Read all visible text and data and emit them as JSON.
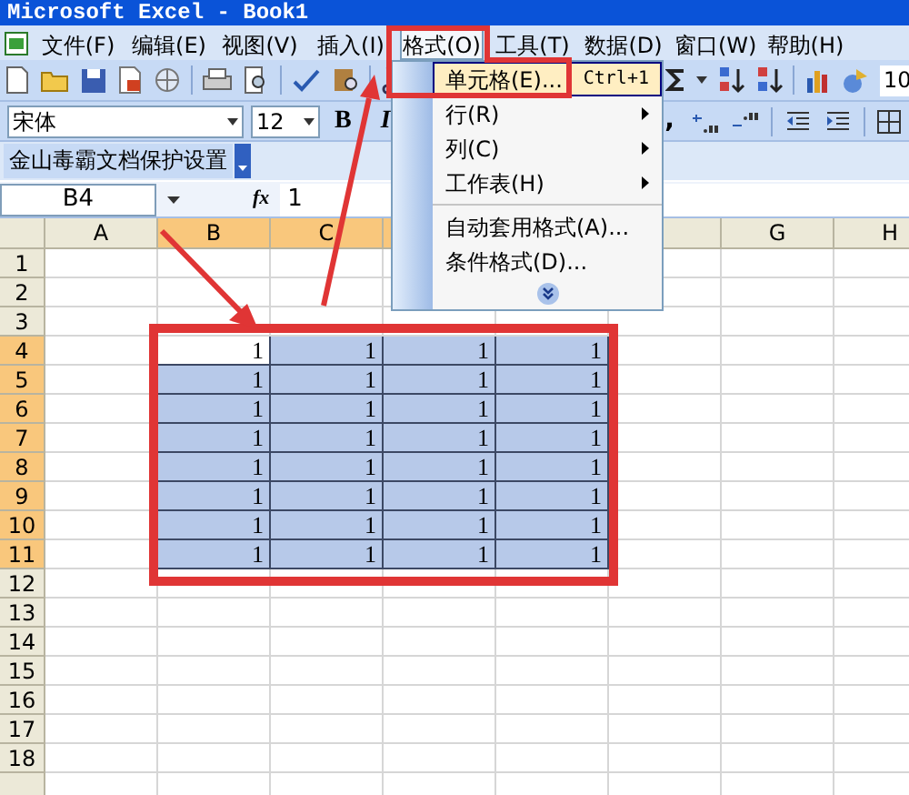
{
  "window": {
    "title": "Microsoft Excel - Book1"
  },
  "menu_bar": [
    {
      "label": "文件(F)",
      "selected": false
    },
    {
      "label": "编辑(E)",
      "selected": false
    },
    {
      "label": "视图(V)",
      "selected": false
    },
    {
      "label": "插入(I)",
      "selected": false
    },
    {
      "label": "格式(O)",
      "selected": true
    },
    {
      "label": "工具(T)",
      "selected": false
    },
    {
      "label": "数据(D)",
      "selected": false
    },
    {
      "label": "窗口(W)",
      "selected": false
    },
    {
      "label": "帮助(H)",
      "selected": false
    }
  ],
  "standard_toolbar": {
    "zoom": "10"
  },
  "formatting_toolbar": {
    "font": "宋体",
    "font_size": "12",
    "bold": "B",
    "italic": "I",
    "comma_style": ","
  },
  "addin_toolbar": {
    "button": "金山毒霸文档保护设置"
  },
  "formula_bar": {
    "name_box": "B4",
    "function_label": "fx",
    "value": "1"
  },
  "sheet": {
    "columns": [
      {
        "label": "A",
        "selected": false
      },
      {
        "label": "B",
        "selected": true
      },
      {
        "label": "C",
        "selected": true
      },
      {
        "selected": true
      },
      {},
      {
        "selected": false
      },
      {
        "label": "G",
        "selected": false
      },
      {
        "label": "H",
        "selected": false
      }
    ],
    "rows": [
      {
        "label": "1",
        "selected": false
      },
      {
        "label": "2",
        "selected": false
      },
      {
        "label": "3",
        "selected": false
      },
      {
        "label": "4",
        "selected": true,
        "cells": [
          {},
          {
            "text": "1",
            "selected": false
          },
          {
            "text": "1",
            "selected": true
          },
          {
            "text": "1",
            "selected": true
          },
          {
            "text": "1",
            "selected": true
          },
          {},
          {},
          {}
        ]
      },
      {
        "label": "5",
        "selected": true,
        "cells": [
          {},
          {
            "text": "1",
            "selected": true
          },
          {
            "text": "1",
            "selected": true
          },
          {
            "text": "1",
            "selected": true
          },
          {
            "text": "1",
            "selected": true
          },
          {},
          {},
          {}
        ]
      },
      {
        "label": "6",
        "selected": true,
        "cells": [
          {},
          {
            "text": "1",
            "selected": true
          },
          {
            "text": "1",
            "selected": true
          },
          {
            "text": "1",
            "selected": true
          },
          {
            "text": "1",
            "selected": true
          },
          {},
          {},
          {}
        ]
      },
      {
        "label": "7",
        "selected": true,
        "cells": [
          {},
          {
            "text": "1",
            "selected": true
          },
          {
            "text": "1",
            "selected": true
          },
          {
            "text": "1",
            "selected": true
          },
          {
            "text": "1",
            "selected": true
          },
          {},
          {},
          {}
        ]
      },
      {
        "label": "8",
        "selected": true,
        "cells": [
          {},
          {
            "text": "1",
            "selected": true
          },
          {
            "text": "1",
            "selected": true
          },
          {
            "text": "1",
            "selected": true
          },
          {
            "text": "1",
            "selected": true
          },
          {},
          {},
          {}
        ]
      },
      {
        "label": "9",
        "selected": true,
        "cells": [
          {},
          {
            "text": "1",
            "selected": true
          },
          {
            "text": "1",
            "selected": true
          },
          {
            "text": "1",
            "selected": true
          },
          {
            "text": "1",
            "selected": true
          },
          {},
          {},
          {}
        ]
      },
      {
        "label": "10",
        "selected": true,
        "cells": [
          {},
          {
            "text": "1",
            "selected": true
          },
          {
            "text": "1",
            "selected": true
          },
          {
            "text": "1",
            "selected": true
          },
          {
            "text": "1",
            "selected": true
          },
          {},
          {},
          {}
        ]
      },
      {
        "label": "11",
        "selected": true,
        "cells": [
          {},
          {
            "text": "1",
            "selected": true
          },
          {
            "text": "1",
            "selected": true
          },
          {
            "text": "1",
            "selected": true
          },
          {
            "text": "1",
            "selected": true
          },
          {},
          {},
          {}
        ]
      },
      {
        "label": "12",
        "selected": false
      },
      {
        "label": "13",
        "selected": false
      },
      {
        "label": "14",
        "selected": false
      },
      {
        "label": "15",
        "selected": false
      },
      {
        "label": "16",
        "selected": false
      },
      {
        "label": "17",
        "selected": false
      },
      {
        "label": "18",
        "selected": false
      },
      {
        "selected": false
      }
    ]
  },
  "format_menu": {
    "items": [
      {
        "kind": "command",
        "label": "单元格(E)...",
        "shortcut": "Ctrl+1",
        "selected": true
      },
      {
        "kind": "submenu",
        "label": "行(R)",
        "selected": false
      },
      {
        "kind": "submenu",
        "label": "列(C)",
        "selected": false
      },
      {
        "kind": "submenu",
        "label": "工作表(H)",
        "selected": false
      },
      {
        "kind": "separator"
      },
      {
        "kind": "command",
        "label": "自动套用格式(A)...",
        "selected": false
      },
      {
        "kind": "command",
        "label": "条件格式(D)...",
        "selected": false
      },
      {
        "kind": "expand"
      }
    ]
  }
}
